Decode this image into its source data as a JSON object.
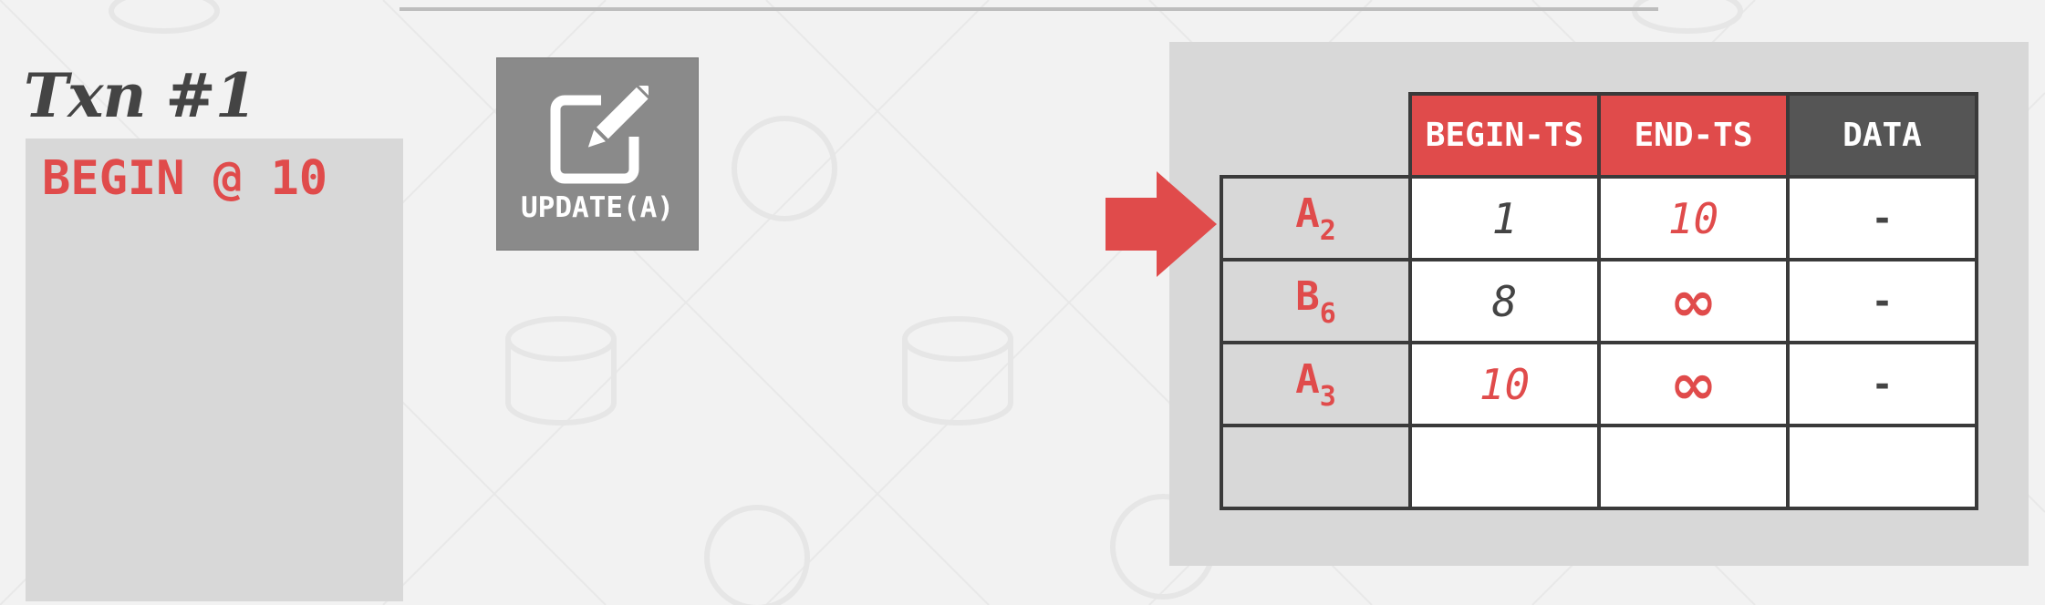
{
  "txn": {
    "title": "Txn #1",
    "statements": [
      "BEGIN @ 10"
    ]
  },
  "operation": {
    "label": "UPDATE(A)",
    "icon": "edit-icon"
  },
  "table": {
    "headers": [
      "BEGIN-TS",
      "END-TS",
      "DATA"
    ],
    "rows": [
      {
        "key": "A",
        "version": "2",
        "begin_ts": "1",
        "end_ts": "10",
        "data": "-"
      },
      {
        "key": "B",
        "version": "6",
        "begin_ts": "8",
        "end_ts": "∞",
        "data": "-"
      },
      {
        "key": "A",
        "version": "3",
        "begin_ts": "10",
        "end_ts": "∞",
        "data": "-"
      }
    ],
    "pointer_row": 0
  },
  "colors": {
    "accent_red": "#e04b4b",
    "dark_header": "#555555",
    "panel_gray": "#d8d8d8",
    "text_dark": "#444444"
  }
}
